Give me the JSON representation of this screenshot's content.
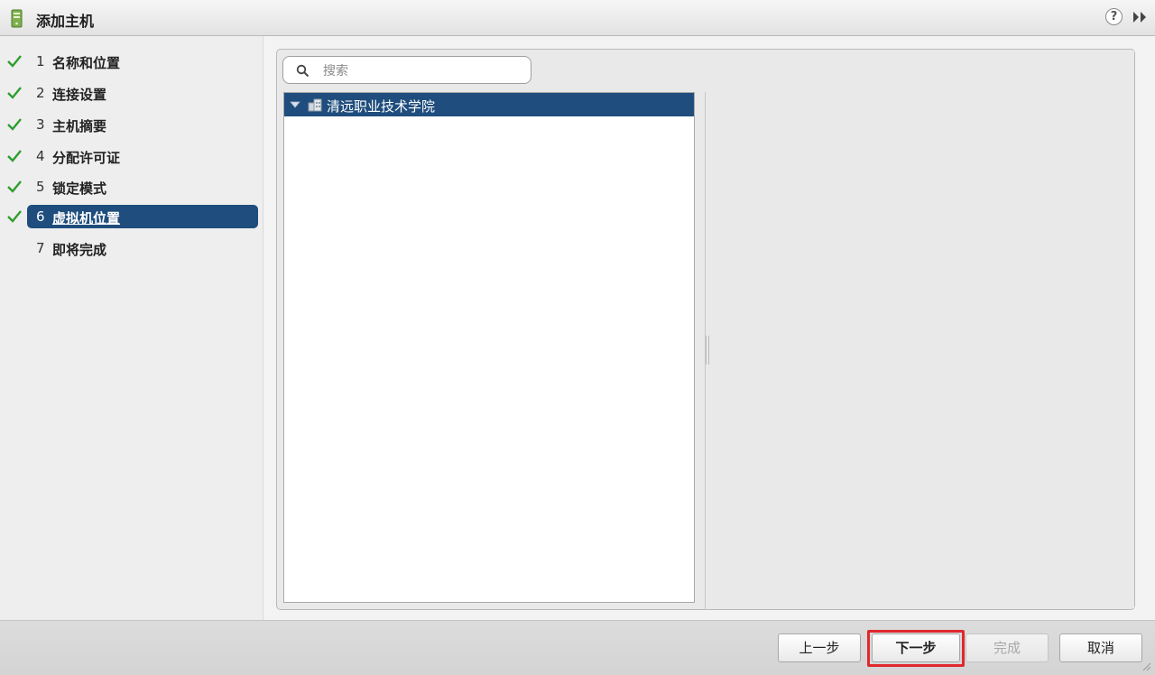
{
  "window": {
    "title": "添加主机",
    "help_label": "?",
    "icons": {
      "title": "host-icon",
      "help": "help-icon",
      "expand": "double-chevron-right-icon"
    }
  },
  "steps": [
    {
      "number": "1",
      "label": "名称和位置",
      "completed": true,
      "active": false
    },
    {
      "number": "2",
      "label": "连接设置",
      "completed": true,
      "active": false
    },
    {
      "number": "3",
      "label": "主机摘要",
      "completed": true,
      "active": false
    },
    {
      "number": "4",
      "label": "分配许可证",
      "completed": true,
      "active": false
    },
    {
      "number": "5",
      "label": "锁定模式",
      "completed": true,
      "active": false
    },
    {
      "number": "6",
      "label": "虚拟机位置",
      "completed": true,
      "active": true
    },
    {
      "number": "7",
      "label": "即将完成",
      "completed": false,
      "active": false
    }
  ],
  "search": {
    "placeholder": "搜索",
    "value": ""
  },
  "tree": {
    "items": [
      {
        "label": "清远职业技术学院",
        "expanded": true,
        "selected": true,
        "icon": "datacenter-icon"
      }
    ]
  },
  "footer": {
    "back_label": "上一步",
    "next_label": "下一步",
    "finish_label": "完成",
    "cancel_label": "取消",
    "finish_disabled": true,
    "highlighted_button": "next"
  },
  "colors": {
    "accent": "#1f4d7d",
    "check": "#2e9e2e",
    "highlight": "#e0282d"
  }
}
